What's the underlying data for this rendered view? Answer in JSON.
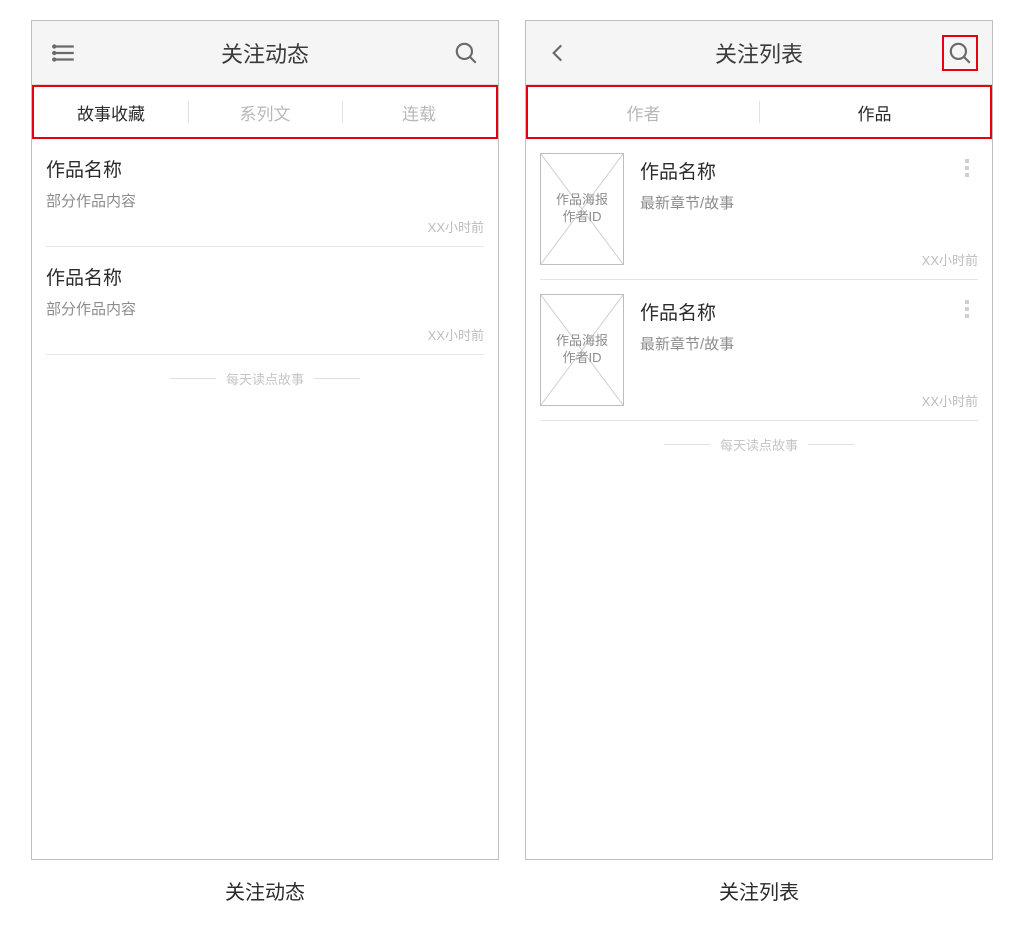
{
  "left": {
    "header": {
      "title": "关注动态"
    },
    "tabs": [
      "故事收藏",
      "系列文",
      "连载"
    ],
    "active_tab_index": 0,
    "items": [
      {
        "title": "作品名称",
        "desc": "部分作品内容",
        "time": "XX小时前"
      },
      {
        "title": "作品名称",
        "desc": "部分作品内容",
        "time": "XX小时前"
      }
    ],
    "tagline": "每天读点故事",
    "caption": "关注动态"
  },
  "right": {
    "header": {
      "title": "关注列表"
    },
    "tabs": [
      "作者",
      "作品"
    ],
    "active_tab_index": 1,
    "thumb_text": "作品海报\n作者ID",
    "items": [
      {
        "title": "作品名称",
        "desc": "最新章节/故事",
        "time": "XX小时前"
      },
      {
        "title": "作品名称",
        "desc": "最新章节/故事",
        "time": "XX小时前"
      }
    ],
    "tagline": "每天读点故事",
    "caption": "关注列表"
  }
}
